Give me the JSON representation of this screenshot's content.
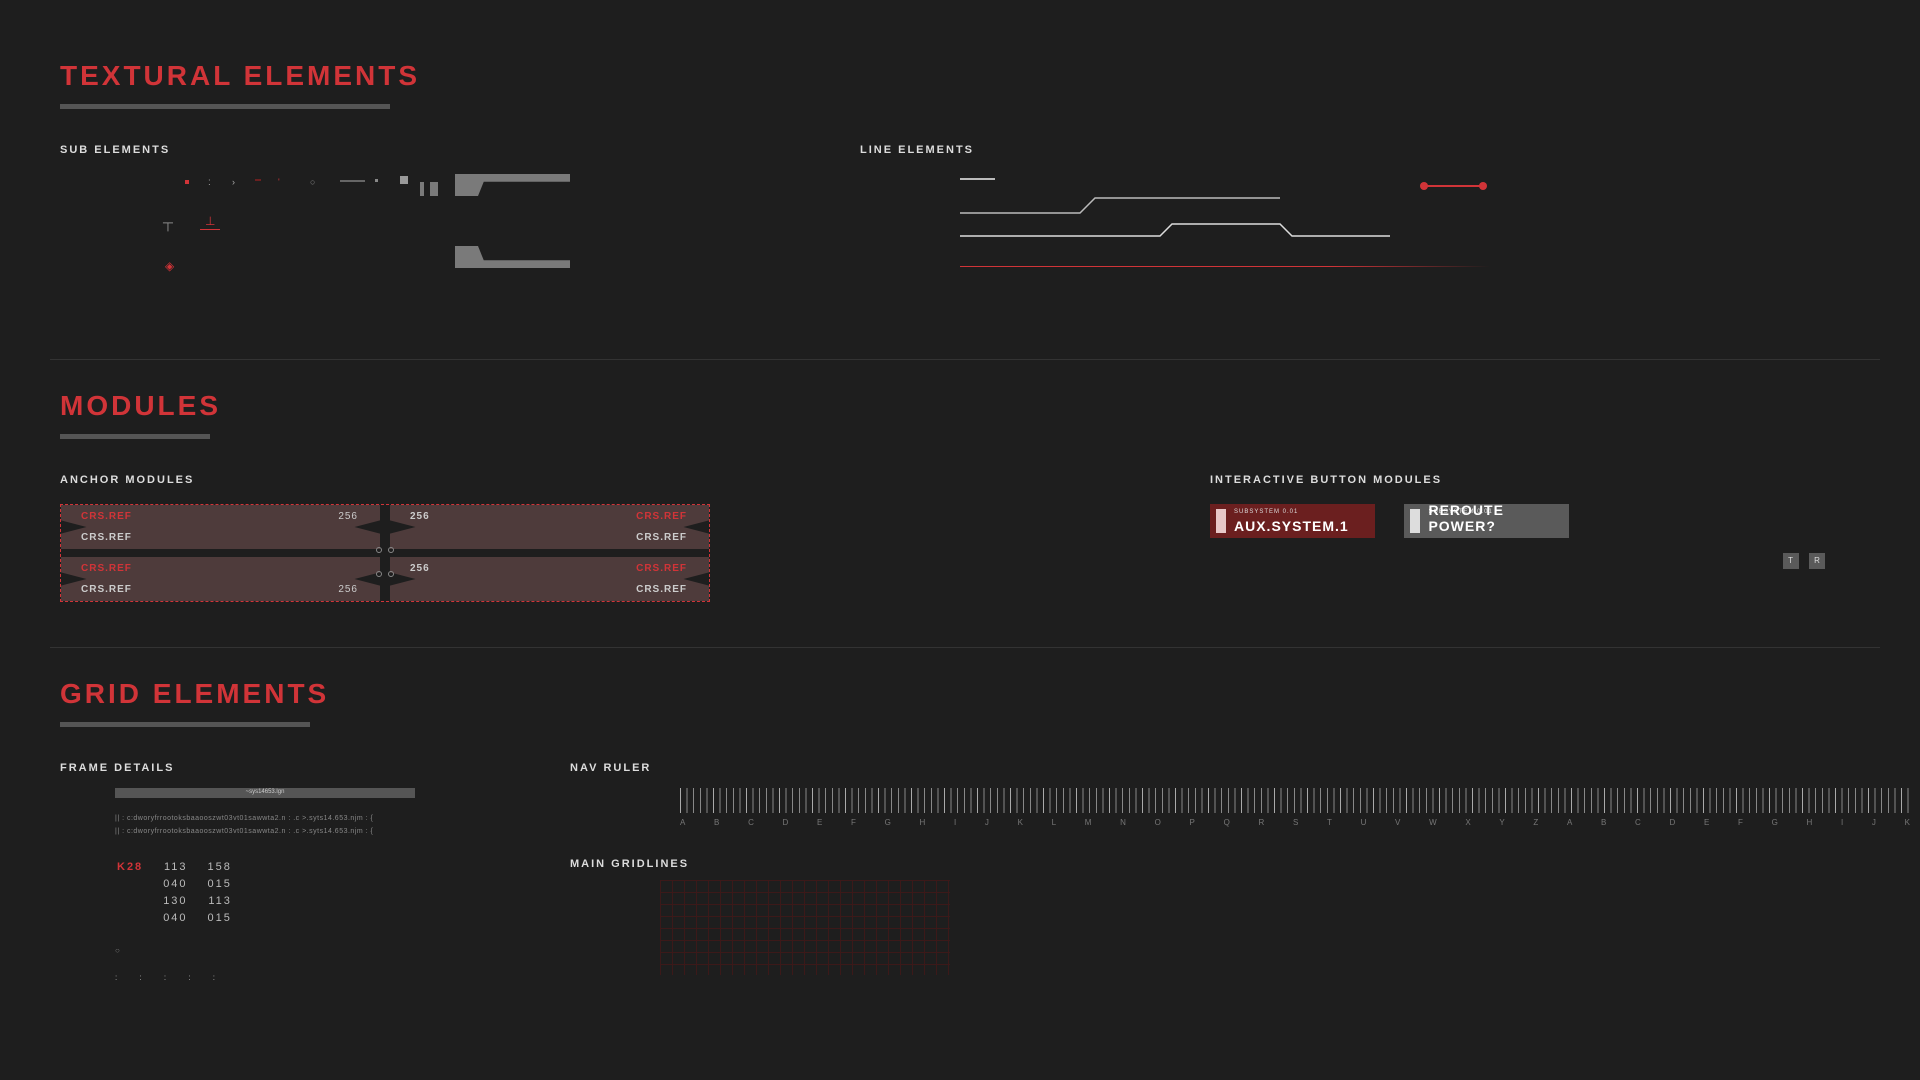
{
  "sections": {
    "textural": {
      "title": "TEXTURAL ELEMENTS",
      "sub1": "SUB ELEMENTS",
      "sub2": "LINE ELEMENTS"
    },
    "modules": {
      "title": "MODULES",
      "sub1": "ANCHOR MODULES",
      "sub2": "INTERACTIVE BUTTON MODULES"
    },
    "grid": {
      "title": "GRID ELEMENTS",
      "sub1": "FRAME DETAILS",
      "sub2": "NAV RULER",
      "sub3": "MAIN GRIDLINES"
    }
  },
  "anchor": {
    "crs_ref": "CRS.REF",
    "num": "256"
  },
  "buttons": {
    "aux": {
      "small": "SUBSYSTEM 0.01",
      "big": "AUX.SYSTEM.1"
    },
    "reroute": {
      "small": "SUBSYSTEM 0.01",
      "big": "REROUTE POWER?"
    },
    "tiny": [
      "T",
      "R"
    ]
  },
  "frame": {
    "barlabel": "~sys14653.lgn",
    "line1": "|| : c:dworyfrrootoksbaaooszwt03vt01sawwta2.n   :  .c   >.syts14.653.njm   :    {",
    "line2": "|| : c:dworyfrrootoksbaaooszwt03vt01sawwta2.n : .c   >.syts14.653.njm   :    {",
    "nums": [
      [
        "K28",
        "113",
        "158"
      ],
      [
        "",
        "040",
        "015"
      ],
      [
        "",
        "130",
        "113"
      ],
      [
        "",
        "040",
        "015"
      ]
    ],
    "dots": ": : : : :"
  },
  "ruler_labels": [
    "A",
    "B",
    "C",
    "D",
    "E",
    "F",
    "G",
    "H",
    "I",
    "J",
    "K",
    "L",
    "M",
    "N",
    "O",
    "P",
    "Q",
    "R",
    "S",
    "T",
    "U",
    "V",
    "W",
    "X",
    "Y",
    "Z",
    "A",
    "B",
    "C",
    "D",
    "E",
    "F",
    "G",
    "H",
    "I",
    "J",
    "K"
  ]
}
